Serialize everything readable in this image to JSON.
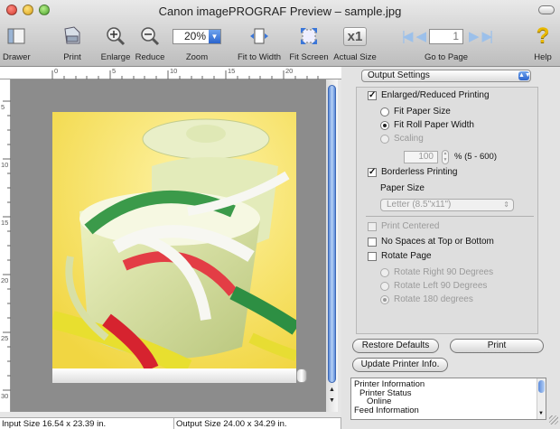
{
  "window": {
    "title": "Canon imagePROGRAF Preview – sample.jpg"
  },
  "toolbar": {
    "drawer": "Drawer",
    "print": "Print",
    "enlarge": "Enlarge",
    "reduce": "Reduce",
    "zoom_label": "Zoom",
    "zoom_value": "20%",
    "fit_width": "Fit to Width",
    "fit_screen": "Fit Screen",
    "actual_size": "Actual Size",
    "actual_size_icon_text": "x1",
    "page_value": "1",
    "go_to_page": "Go to Page",
    "help": "Help"
  },
  "ruler": {
    "h": [
      "0",
      "5",
      "10",
      "15",
      "20",
      "25"
    ],
    "v": [
      "5",
      "10",
      "15",
      "20",
      "25",
      "30"
    ]
  },
  "status": {
    "input_size": "Input Size 16.54 x 23.39 in.",
    "output_size": "Output Size 24.00 x 34.29 in."
  },
  "panel": {
    "settings_popup": "Output Settings",
    "enlarged_printing": "Enlarged/Reduced Printing",
    "fit_paper_size": "Fit Paper Size",
    "fit_roll_width": "Fit Roll Paper Width",
    "scaling": "Scaling",
    "scaling_value": "100",
    "scaling_unit": "% (5 - 600)",
    "borderless": "Borderless Printing",
    "paper_size_label": "Paper Size",
    "paper_size_value": "Letter (8.5\"x11\")",
    "print_centered": "Print Centered",
    "no_spaces": "No Spaces at Top or Bottom",
    "rotate_page": "Rotate Page",
    "rotate_right": "Rotate Right 90 Degrees",
    "rotate_left": "Rotate Left 90 Degrees",
    "rotate_180": "Rotate 180 degrees",
    "restore_defaults": "Restore Defaults",
    "print_button": "Print",
    "update_printer": "Update Printer Info.",
    "info_lines": [
      "Printer Information",
      "Printer Status",
      "Online",
      "Feed Information"
    ]
  },
  "colors": {
    "accent": "#2a64cd",
    "canvas": "#8c8c8c",
    "panel": "#e3e3e3"
  }
}
